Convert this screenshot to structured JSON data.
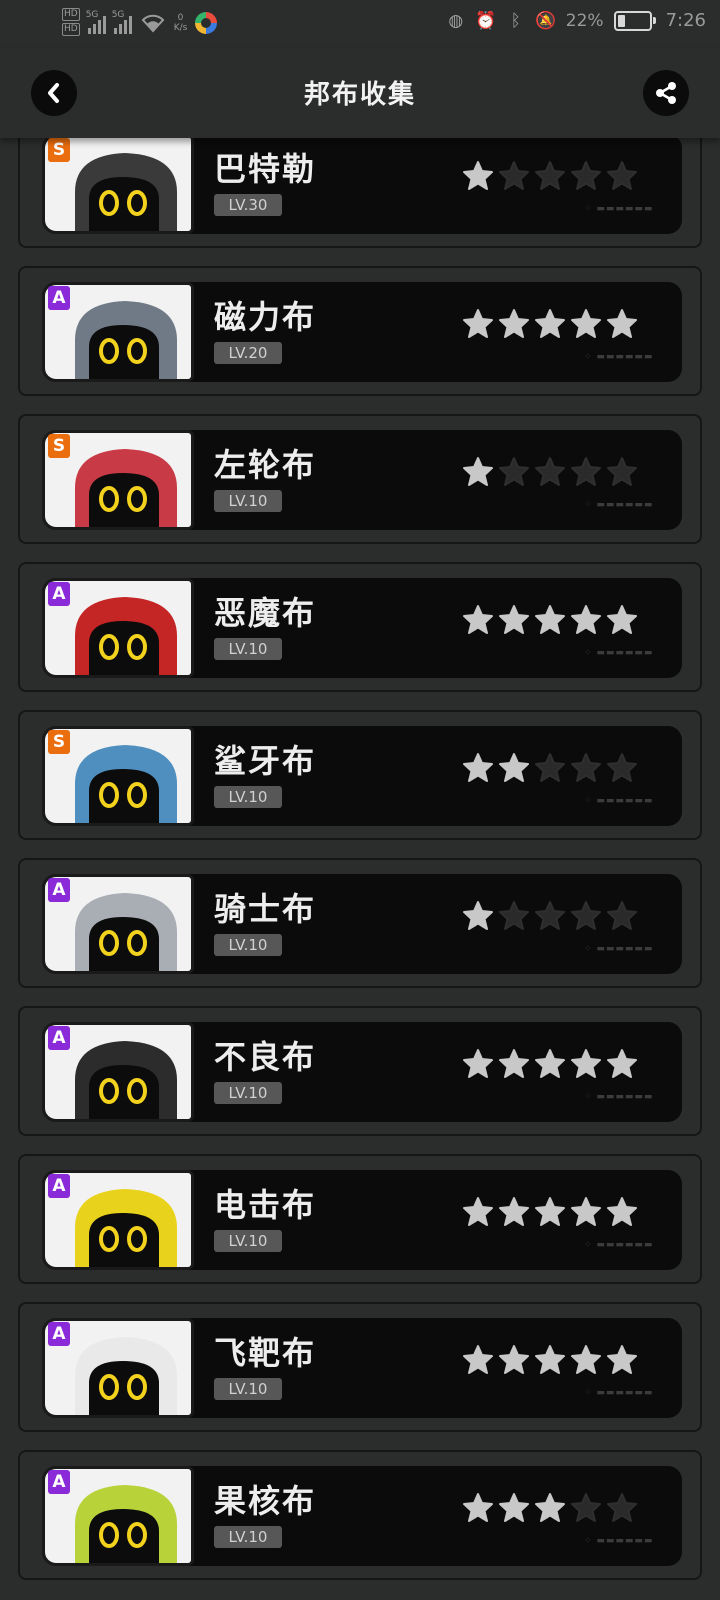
{
  "status_bar": {
    "network_type": "5G",
    "speed_value": "0",
    "speed_unit": "K/s",
    "battery": "22%",
    "time": "7:26"
  },
  "header": {
    "title": "邦布收集",
    "back_icon": "chevron-left-icon",
    "share_icon": "share-icon"
  },
  "bangboos": [
    {
      "name": "巴特勒",
      "rank": "S",
      "level": "LV.30",
      "stars": 1,
      "theme": "#3a3a3a"
    },
    {
      "name": "磁力布",
      "rank": "A",
      "level": "LV.20",
      "stars": 5,
      "theme": "#6f7a86"
    },
    {
      "name": "左轮布",
      "rank": "S",
      "level": "LV.10",
      "stars": 1,
      "theme": "#c83a45"
    },
    {
      "name": "恶魔布",
      "rank": "A",
      "level": "LV.10",
      "stars": 5,
      "theme": "#c42525"
    },
    {
      "name": "鲨牙布",
      "rank": "S",
      "level": "LV.10",
      "stars": 2,
      "theme": "#4f8fbf"
    },
    {
      "name": "骑士布",
      "rank": "A",
      "level": "LV.10",
      "stars": 1,
      "theme": "#a9aeb4"
    },
    {
      "name": "不良布",
      "rank": "A",
      "level": "LV.10",
      "stars": 5,
      "theme": "#2c2c2c"
    },
    {
      "name": "电击布",
      "rank": "A",
      "level": "LV.10",
      "stars": 5,
      "theme": "#e8d21c"
    },
    {
      "name": "飞靶布",
      "rank": "A",
      "level": "LV.10",
      "stars": 5,
      "theme": "#e9e9e9"
    },
    {
      "name": "果核布",
      "rank": "A",
      "level": "LV.10",
      "stars": 3,
      "theme": "#b8d23a"
    }
  ],
  "colors": {
    "star_filled": "#c8c8c8",
    "star_empty": "#2a2a2a",
    "rank_S": "#ea6d0e",
    "rank_A": "#8a2ad8"
  }
}
